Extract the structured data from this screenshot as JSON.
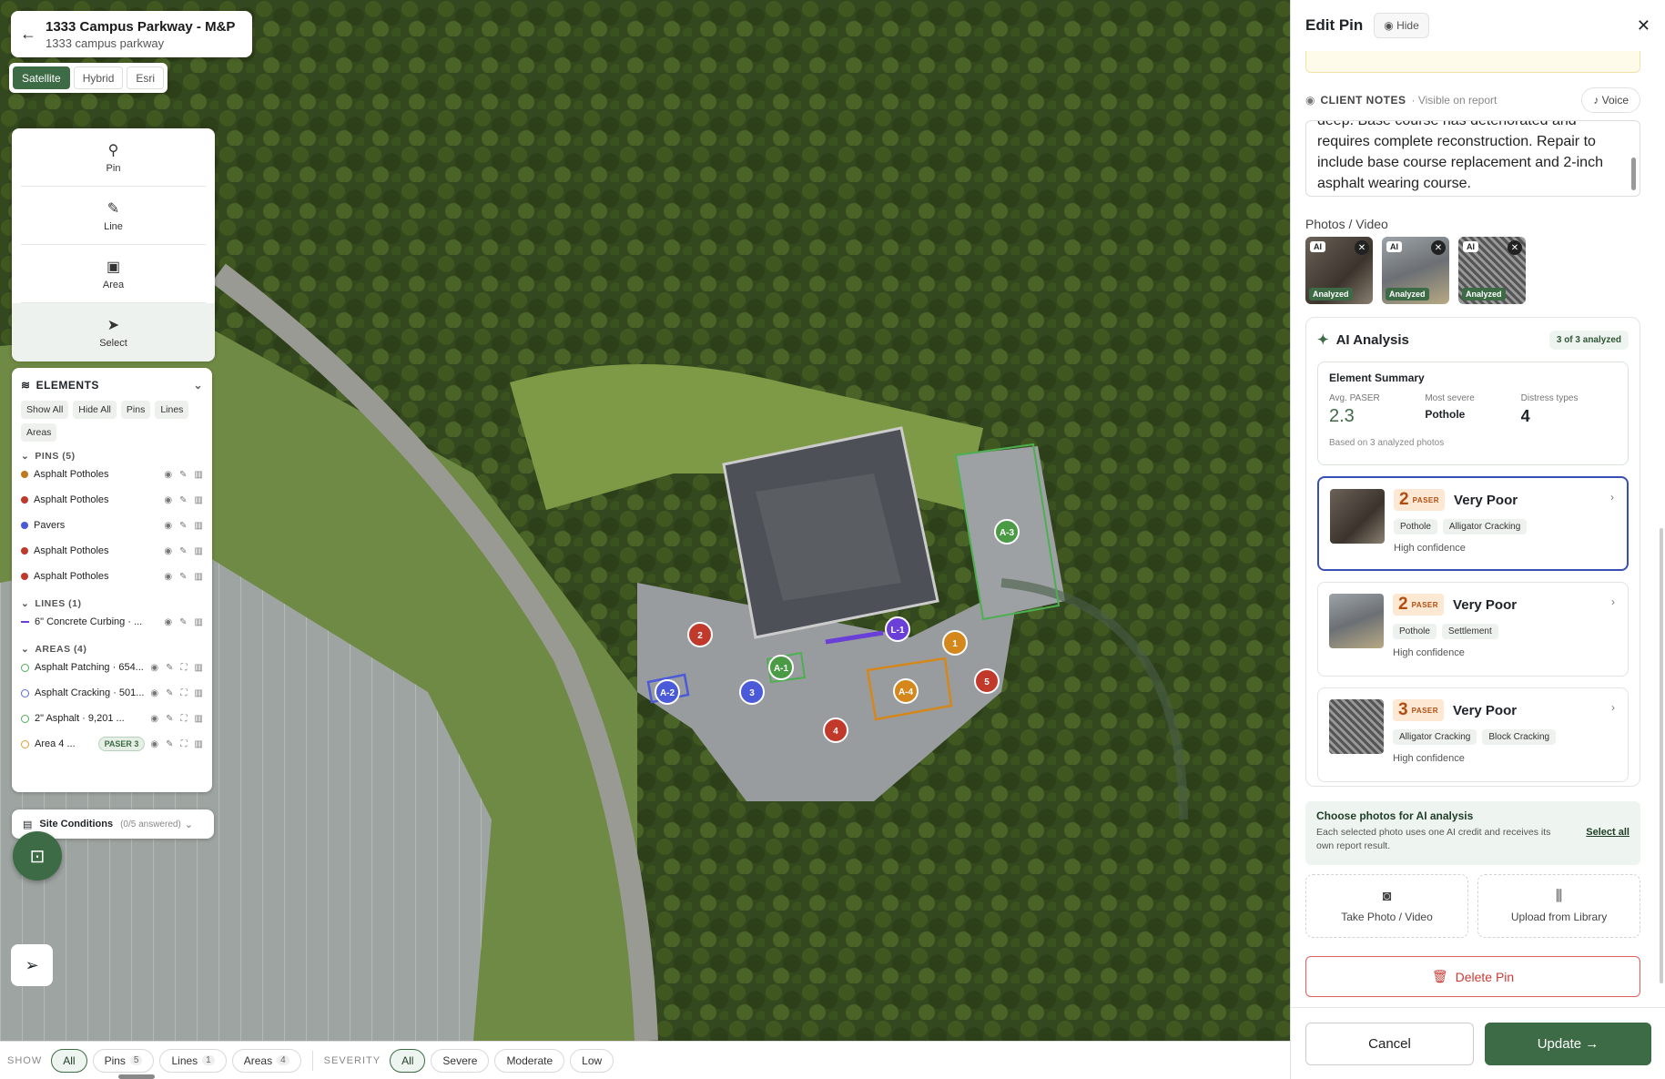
{
  "header": {
    "back_icon": "arrow-left-icon",
    "title": "1333 Campus Parkway - M&P",
    "subtitle": "1333 campus parkway"
  },
  "map_types": [
    "Satellite",
    "Hybrid",
    "Esri"
  ],
  "tools": [
    {
      "icon": "pin-icon",
      "label": "Pin"
    },
    {
      "icon": "ruler-icon",
      "label": "Line"
    },
    {
      "icon": "area-icon",
      "label": "Area"
    },
    {
      "icon": "cursor-icon",
      "label": "Select"
    }
  ],
  "elements": {
    "title": "ELEMENTS",
    "filters": [
      "Show All",
      "Hide All",
      "Pins",
      "Lines",
      "Areas"
    ],
    "pins_label": "PINS (5)",
    "pins": [
      {
        "label": "Asphalt Potholes",
        "color": "#c0781c"
      },
      {
        "label": "Asphalt Potholes",
        "color": "#c0392b"
      },
      {
        "label": "Pavers",
        "color": "#4a5ad8"
      },
      {
        "label": "Asphalt Potholes",
        "color": "#c0392b"
      },
      {
        "label": "Asphalt Potholes",
        "color": "#c0392b"
      }
    ],
    "lines_label": "LINES (1)",
    "lines": [
      {
        "label": "6\" Concrete Curbing · ...",
        "color": "#6a3fd8"
      }
    ],
    "areas_label": "AREAS (4)",
    "areas": [
      {
        "label": "Asphalt Patching · 654...",
        "color": "#4caf50"
      },
      {
        "label": "Asphalt Cracking · 501...",
        "color": "#5b6be0"
      },
      {
        "label": "2\" Asphalt · 9,201 ...",
        "color": "#4caf50"
      },
      {
        "label": "Area 4 ...",
        "color": "#e0a030",
        "badge": "PASER 3"
      }
    ]
  },
  "site_conditions": {
    "label": "Site Conditions",
    "count": "(0/5 answered)"
  },
  "map_markers": [
    {
      "label": "2",
      "color": "#c0392b"
    },
    {
      "label": "L-1",
      "color": "#6a3fd8"
    },
    {
      "label": "1",
      "color": "#d4881c"
    },
    {
      "label": "5",
      "color": "#c0392b"
    },
    {
      "label": "A-3",
      "color": "#4a9a46"
    },
    {
      "label": "A-1",
      "color": "#4a9a46"
    },
    {
      "label": "A-2",
      "color": "#4a5ad8"
    },
    {
      "label": "3",
      "color": "#4a5ad8"
    },
    {
      "label": "A-4",
      "color": "#d4881c"
    },
    {
      "label": "4",
      "color": "#c0392b"
    }
  ],
  "bottom": {
    "show_label": "SHOW",
    "show": [
      {
        "label": "All"
      },
      {
        "label": "Pins",
        "count": "5"
      },
      {
        "label": "Lines",
        "count": "1"
      },
      {
        "label": "Areas",
        "count": "4"
      }
    ],
    "severity_label": "SEVERITY",
    "severity": [
      "All",
      "Severe",
      "Moderate",
      "Low"
    ]
  },
  "panel": {
    "title": "Edit Pin",
    "hide": "Hide",
    "client_notes": "CLIENT NOTES",
    "visible": "· Visible on report",
    "voice": "Voice",
    "notes_text": "deep. Base course has deteriorated and requires complete reconstruction. Repair to include base course replacement and 2-inch asphalt wearing course.",
    "photos_label": "Photos / Video",
    "photo_ai": "AI",
    "photo_status": "Analyzed",
    "ai": {
      "title": "AI Analysis",
      "pill": "3 of 3 analyzed",
      "summary_title": "Element Summary",
      "avg_label": "Avg. PASER",
      "avg": "2.3",
      "severe_label": "Most severe",
      "severe": "Pothole",
      "types_label": "Distress types",
      "types": "4",
      "based": "Based on 3 analyzed photos",
      "paser_word": "PASER",
      "results": [
        {
          "score": "2",
          "condition": "Very Poor",
          "tags": [
            "Pothole",
            "Alligator Cracking"
          ],
          "confidence": "High confidence"
        },
        {
          "score": "2",
          "condition": "Very Poor",
          "tags": [
            "Pothole",
            "Settlement"
          ],
          "confidence": "High confidence"
        },
        {
          "score": "3",
          "condition": "Very Poor",
          "tags": [
            "Alligator Cracking",
            "Block Cracking"
          ],
          "confidence": "High confidence"
        }
      ]
    },
    "choose_title": "Choose photos for AI analysis",
    "choose_desc": "Each selected photo uses one AI credit and receives its own report result.",
    "select_all": "Select all",
    "take_photo": "Take Photo / Video",
    "upload": "Upload from Library",
    "delete": "Delete Pin",
    "cancel": "Cancel",
    "update": "Update →"
  }
}
